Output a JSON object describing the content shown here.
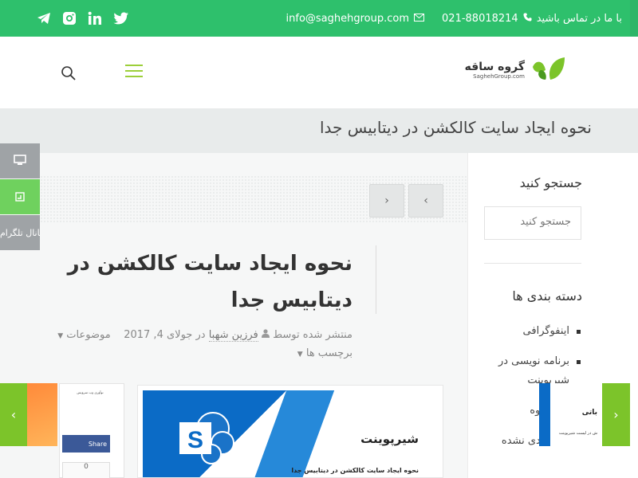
{
  "topbar": {
    "contact_prefix": "با ما در تماس باشید",
    "phone": "021-88018214",
    "email": "info@saghehgroup.com",
    "social_icons": [
      "telegram-icon",
      "instagram-icon",
      "linkedin-icon",
      "twitter-icon"
    ],
    "color": "#2ec06c"
  },
  "header": {
    "logo_name": "گروه ساقه",
    "logo_domain": "SaghehGroup.com"
  },
  "page_title": "نحوه ایجاد سایت کالکشن در دیتابیس جدا",
  "side_buttons": {
    "telegram_label": "کانال تلگرام"
  },
  "post": {
    "title": "نحوه ایجاد سایت کالکشن در دیتابیس جدا",
    "meta_published": "منتشر شده توسط",
    "author": "فرزین شهبا",
    "meta_in": "در",
    "date": "جولای 4, 2017",
    "topics_label": "موضوعات",
    "tags_label": "برچسب ها",
    "image_heading": "شیرپوینت",
    "image_caption": "نحوه ایجاد سایت کالکشن در دیتابیس جدا"
  },
  "small_card": {
    "heading": "نوآوری وب سرویس",
    "share_label": "Share",
    "count": "0"
  },
  "sidebar": {
    "search_title": "جستجو کنید",
    "search_placeholder": "جستجو کنید",
    "categories_title": "دسته بندی ها",
    "categories": [
      "اینفوگرافی",
      "برنامه نویسی در شیرپوینت",
      "خبر گروه",
      "دسته‌بندی نشده"
    ]
  },
  "float_right": {
    "title": "باتی",
    "sub": "ش در لیست شیرپوینت"
  },
  "colors": {
    "accent_green": "#7cc42a",
    "sharepoint_blue": "#0b6bc6"
  }
}
